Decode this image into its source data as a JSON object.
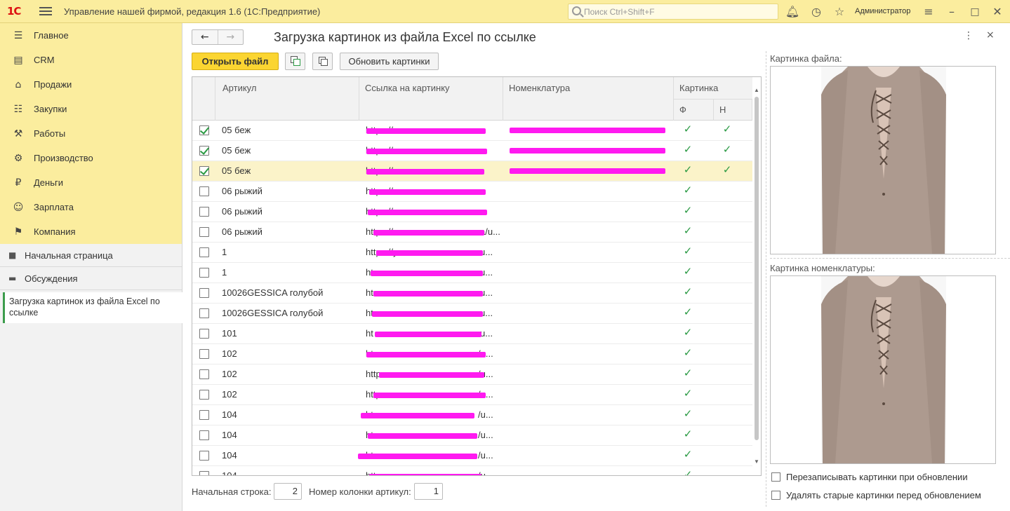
{
  "titlebar": {
    "logo": "1С",
    "app_title": "Управление нашей фирмой, редакция 1.6  (1С:Предприятие)",
    "search_placeholder": "Поиск Ctrl+Shift+F",
    "user": "Администратор",
    "icons": [
      "bell-icon",
      "history-icon",
      "star-icon",
      "settings-icon",
      "minimize-icon",
      "maximize-icon",
      "close-icon"
    ]
  },
  "sidebar": {
    "sections": [
      {
        "label": "Главное",
        "icon": "menu-icon"
      },
      {
        "label": "CRM",
        "icon": "crm-icon"
      },
      {
        "label": "Продажи",
        "icon": "basket-icon"
      },
      {
        "label": "Закупки",
        "icon": "purchases-icon"
      },
      {
        "label": "Работы",
        "icon": "tools-icon"
      },
      {
        "label": "Производство",
        "icon": "factory-icon"
      },
      {
        "label": "Деньги",
        "icon": "money-icon"
      },
      {
        "label": "Зарплата",
        "icon": "salary-icon"
      },
      {
        "label": "Компания",
        "icon": "flag-icon"
      }
    ],
    "nav": [
      {
        "label": "Начальная страница",
        "icon": "home-icon"
      },
      {
        "label": "Обсуждения",
        "icon": "chat-icon"
      }
    ],
    "open_form": "Загрузка картинок из файла Excel по ссылке"
  },
  "form": {
    "title": "Загрузка картинок из файла Excel по ссылке",
    "back_icon": "←",
    "forward_icon": "→",
    "more_icon": "⋮",
    "close_icon": "×",
    "open_file": "Открыть файл",
    "refresh_images": "Обновить картинки",
    "table": {
      "columns": {
        "article": "Артикул",
        "link": "Ссылка на картинку",
        "nomenclature": "Номенклатура",
        "image": "Картинка",
        "image_file": "Ф",
        "image_nom": "Н"
      },
      "rows": [
        {
          "checked": true,
          "article": "05 беж",
          "link": "https://...",
          "nom": true,
          "f": "✓",
          "n": "✓",
          "selected": false
        },
        {
          "checked": true,
          "article": "05 беж",
          "link": "https://...",
          "nom": true,
          "f": "✓",
          "n": "✓",
          "selected": false
        },
        {
          "checked": true,
          "article": "05 беж",
          "link": "https://...",
          "nom": true,
          "f": "✓",
          "n": "✓",
          "selected": true
        },
        {
          "checked": false,
          "article": "06 рыжий",
          "link": "https://...",
          "nom": false,
          "f": "✓",
          "n": "",
          "selected": false
        },
        {
          "checked": false,
          "article": "06 рыжий",
          "link": "https://...",
          "nom": false,
          "f": "✓",
          "n": "",
          "selected": false
        },
        {
          "checked": false,
          "article": "06 рыжий",
          "link": "https://w",
          "link_end": "a/u...",
          "nom": false,
          "f": "✓",
          "n": "",
          "selected": false
        },
        {
          "checked": false,
          "article": "1",
          "link": "https://y",
          "link_end": "u...",
          "nom": false,
          "f": "✓",
          "n": "",
          "selected": false
        },
        {
          "checked": false,
          "article": "1",
          "link": "ht",
          "link_end": "u...",
          "nom": false,
          "f": "✓",
          "n": "",
          "selected": false
        },
        {
          "checked": false,
          "article": "10026GESSICA голубой",
          "link": "ht",
          "link_end": "u...",
          "nom": false,
          "f": "✓",
          "n": "",
          "selected": false
        },
        {
          "checked": false,
          "article": "10026GESSICA голубой",
          "link": "ht",
          "link_end": "u...",
          "nom": false,
          "f": "✓",
          "n": "",
          "selected": false
        },
        {
          "checked": false,
          "article": "101",
          "link": "ht",
          "link_end": "u...",
          "nom": false,
          "f": "✓",
          "n": "",
          "selected": false
        },
        {
          "checked": false,
          "article": "102",
          "link": "ht",
          "link_end": "/u...",
          "nom": false,
          "f": "✓",
          "n": "",
          "selected": false
        },
        {
          "checked": false,
          "article": "102",
          "link": "http",
          "link_end": "/u...",
          "nom": false,
          "f": "✓",
          "n": "",
          "selected": false
        },
        {
          "checked": false,
          "article": "102",
          "link": "http",
          "link_end": "/u...",
          "nom": false,
          "f": "✓",
          "n": "",
          "selected": false
        },
        {
          "checked": false,
          "article": "104",
          "link": "ht",
          "link_end": "/u...",
          "nom": false,
          "f": "✓",
          "n": "",
          "selected": false
        },
        {
          "checked": false,
          "article": "104",
          "link": "ht",
          "link_end": "/u...",
          "nom": false,
          "f": "✓",
          "n": "",
          "selected": false
        },
        {
          "checked": false,
          "article": "104",
          "link": "ht",
          "link_end": "/u...",
          "nom": false,
          "f": "✓",
          "n": "",
          "selected": false
        },
        {
          "checked": false,
          "article": "104",
          "link": "https",
          "link_end": "/u...",
          "nom": false,
          "f": "✓",
          "n": "",
          "selected": false
        }
      ]
    },
    "start_row_label": "Начальная строка:",
    "start_row_value": "2",
    "article_col_label": "Номер колонки артикул:",
    "article_col_value": "1",
    "file_image_label": "Картинка файла:",
    "nom_image_label": "Картинка номенклатуры:",
    "overwrite_label": "Перезаписывать картинки при обновлении",
    "delete_old_label": "Удалять старые картинки перед обновлением"
  },
  "colors": {
    "accent_yellow": "#fbed9e",
    "button_yellow": "#fbd531",
    "check_green": "#2a9a43",
    "redaction_magenta": "#ff1af0"
  }
}
